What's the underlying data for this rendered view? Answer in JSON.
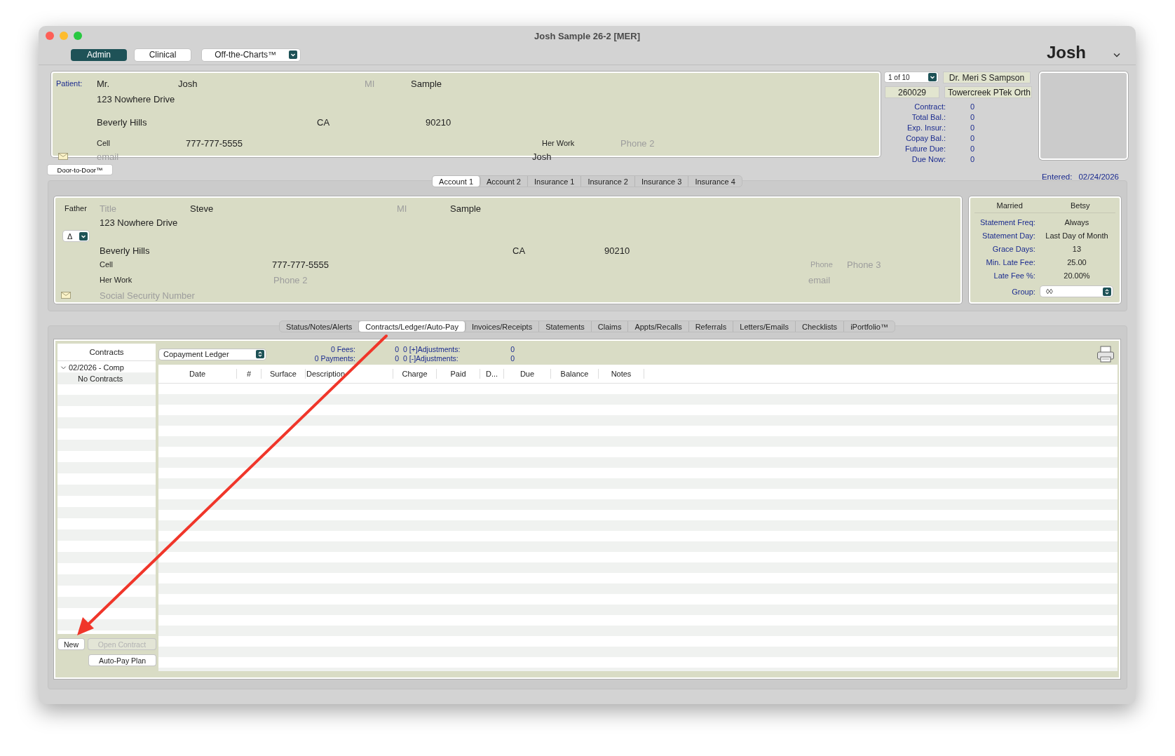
{
  "window": {
    "title": "Josh Sample 26-2 [MER]"
  },
  "modes": [
    {
      "label": "Admin",
      "selected": true
    },
    {
      "label": "Clinical",
      "selected": false
    }
  ],
  "chart_menu": {
    "label": "Off-the-Charts™"
  },
  "user": {
    "name": "Josh"
  },
  "patient": {
    "label": "Patient:",
    "title": "Mr.",
    "first_name": "Josh",
    "middle": {
      "placeholder": "MI"
    },
    "last_name": "Sample",
    "address": "123 Nowhere Drive",
    "city": "Beverly Hills",
    "state": "CA",
    "zip": "90210",
    "phone_label": "Cell",
    "phone": "777-777-5555",
    "phone2_label": "Her Work",
    "phone2": {
      "placeholder": "Phone 2"
    },
    "email": {
      "placeholder": "email"
    },
    "contact": "Josh"
  },
  "record": {
    "picker": "1 of 10",
    "id": "260029",
    "doctor": "Dr. Meri S Sampson",
    "office": "Towercreek PTek Orth",
    "balances": [
      {
        "label": "Contract:",
        "value": "0"
      },
      {
        "label": "Total Bal.:",
        "value": "0"
      },
      {
        "label": "Exp. Insur.:",
        "value": "0"
      },
      {
        "label": "Copay Bal.:",
        "value": "0"
      },
      {
        "label": "Future Due:",
        "value": "0"
      },
      {
        "label": "Due Now:",
        "value": "0"
      }
    ]
  },
  "door_button": {
    "label": "Door-to-Door™"
  },
  "entered": {
    "label": "Entered:",
    "value": "02/24/2026"
  },
  "account_tabs": [
    {
      "label": "Account 1",
      "selected": true
    },
    {
      "label": "Account 2",
      "selected": false
    },
    {
      "label": "Insurance 1",
      "selected": false
    },
    {
      "label": "Insurance 2",
      "selected": false
    },
    {
      "label": "Insurance 3",
      "selected": false
    },
    {
      "label": "Insurance 4",
      "selected": false
    }
  ],
  "responsible": {
    "relation": "Father",
    "title": {
      "placeholder": "Title"
    },
    "first_name": "Steve",
    "middle": {
      "placeholder": "MI"
    },
    "last_name": "Sample",
    "address": "123 Nowhere Drive",
    "menu": "Δ",
    "city": "Beverly Hills",
    "state": "CA",
    "zip": "90210",
    "phone_label": "Cell",
    "phone": "777-777-5555",
    "phone3_label": "Phone",
    "phone3": {
      "placeholder": "Phone 3"
    },
    "phone2_label": "Her Work",
    "phone2": {
      "placeholder": "Phone 2"
    },
    "email": {
      "placeholder": "email"
    },
    "ssn": {
      "placeholder": "Social Security Number"
    }
  },
  "terms": {
    "marital": "Married",
    "spouse": "Betsy",
    "rows": [
      {
        "label": "Statement Freq:",
        "value": "Always"
      },
      {
        "label": "Statement Day:",
        "value": "Last Day of Month"
      },
      {
        "label": "Grace Days:",
        "value": "13"
      },
      {
        "label": "Min. Late Fee:",
        "value": "25.00"
      },
      {
        "label": "Late Fee %:",
        "value": "20.00%"
      }
    ],
    "group_label": "Group:",
    "group": "◊◊"
  },
  "section_tabs": [
    {
      "label": "Status/Notes/Alerts",
      "selected": false
    },
    {
      "label": "Contracts/Ledger/Auto-Pay",
      "selected": true
    },
    {
      "label": "Invoices/Receipts",
      "selected": false
    },
    {
      "label": "Statements",
      "selected": false
    },
    {
      "label": "Claims",
      "selected": false
    },
    {
      "label": "Appts/Recalls",
      "selected": false
    },
    {
      "label": "Referrals",
      "selected": false
    },
    {
      "label": "Letters/Emails",
      "selected": false
    },
    {
      "label": "Checklists",
      "selected": false
    },
    {
      "label": "iPortfolio™",
      "selected": false
    }
  ],
  "contracts": {
    "header": "Contracts",
    "tree": [
      {
        "label": "02/2026 - Comp",
        "expanded": true,
        "children": [
          {
            "label": "No Contracts"
          }
        ]
      }
    ],
    "buttons": [
      {
        "label": "New",
        "disabled": false
      },
      {
        "label": "Open Contract",
        "disabled": true
      },
      {
        "label": "Auto-Pay Plan",
        "disabled": false
      }
    ]
  },
  "ledger": {
    "view": "Copayment Ledger",
    "totals": [
      {
        "label": "0 Fees:",
        "value": "0"
      },
      {
        "label": "0 [+]Adjustments:",
        "value": "0"
      },
      {
        "label": "0 Payments:",
        "value": "0"
      },
      {
        "label": "0 [-]Adjustments:",
        "value": "0"
      }
    ],
    "columns": [
      "Date",
      "#",
      "Surface",
      "Description",
      "Charge",
      "Paid",
      "D...",
      "Due",
      "Balance",
      "Notes"
    ]
  }
}
